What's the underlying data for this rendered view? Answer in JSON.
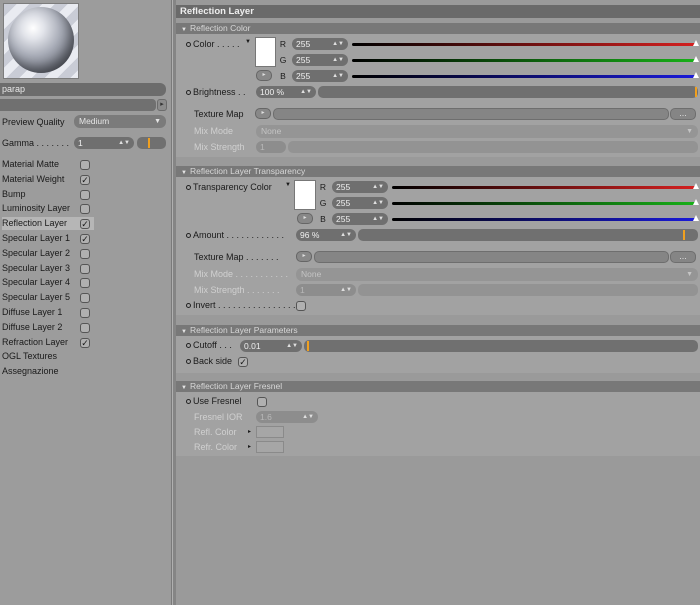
{
  "left_panel": {
    "material_name": "parap",
    "preview_quality": {
      "label": "Preview Quality",
      "value": "Medium"
    },
    "gamma": {
      "label": "Gamma",
      "value": "1"
    },
    "channels": [
      {
        "label": "Material Matte",
        "checked": false
      },
      {
        "label": "Material Weight",
        "checked": true
      },
      {
        "label": "Bump",
        "checked": false
      },
      {
        "label": "Luminosity Layer",
        "checked": false
      },
      {
        "label": "Reflection Layer",
        "checked": true,
        "active": true
      },
      {
        "label": "Specular Layer 1",
        "checked": true
      },
      {
        "label": "Specular Layer 2",
        "checked": false
      },
      {
        "label": "Specular Layer 3",
        "checked": false
      },
      {
        "label": "Specular Layer 4",
        "checked": false
      },
      {
        "label": "Specular Layer 5",
        "checked": false
      },
      {
        "label": "Diffuse Layer 1",
        "checked": false
      },
      {
        "label": "Diffuse Layer 2",
        "checked": false
      },
      {
        "label": "Refraction Layer",
        "checked": true
      }
    ],
    "extra_items": [
      "OGL Textures",
      "Assegnazione"
    ]
  },
  "panel_title": "Reflection Layer",
  "reflection_color": {
    "header": "Reflection Color",
    "color_label": "Color",
    "r": {
      "label": "R",
      "value": "255",
      "fraction": 1.0
    },
    "g": {
      "label": "G",
      "value": "255",
      "fraction": 1.0
    },
    "b": {
      "label": "B",
      "value": "255",
      "fraction": 1.0
    },
    "brightness": {
      "label": "Brightness",
      "value": "100 %",
      "fraction": 1.0
    },
    "texture_map_label": "Texture Map",
    "mix_mode": {
      "label": "Mix Mode",
      "value": "None"
    },
    "mix_strength": {
      "label": "Mix Strength",
      "value": "1"
    }
  },
  "transparency": {
    "header": "Reflection Layer Transparency",
    "color_label": "Transparency Color",
    "r": {
      "label": "R",
      "value": "255",
      "fraction": 1.0
    },
    "g": {
      "label": "G",
      "value": "255",
      "fraction": 1.0
    },
    "b": {
      "label": "B",
      "value": "255",
      "fraction": 1.0
    },
    "amount": {
      "label": "Amount",
      "value": "96 %",
      "fraction": 0.96
    },
    "texture_map_label": "Texture Map",
    "mix_mode": {
      "label": "Mix Mode",
      "value": "None"
    },
    "mix_strength": {
      "label": "Mix Strength",
      "value": "1"
    },
    "invert": {
      "label": "Invert",
      "checked": false
    }
  },
  "parameters": {
    "header": "Reflection Layer Parameters",
    "cutoff": {
      "label": "Cutoff",
      "value": "0.01",
      "fraction": 0.01
    },
    "back_side": {
      "label": "Back side",
      "checked": true
    }
  },
  "fresnel": {
    "header": "Reflection Layer Fresnel",
    "use_fresnel": {
      "label": "Use Fresnel",
      "checked": false
    },
    "fresnel_ior": {
      "label": "Fresnel IOR",
      "value": "1.6"
    },
    "refl_color": {
      "label": "Refl. Color"
    },
    "refr_color": {
      "label": "Refr. Color"
    }
  },
  "colors": {
    "red": "#d42020",
    "green": "#18b018",
    "blue": "#1a1ad8",
    "marker": "#f0a020"
  },
  "icons": {
    "dropdown": "▼",
    "spinner": "⬍",
    "small_arrow": "▸",
    "collapse": "▼",
    "dots": "..."
  }
}
